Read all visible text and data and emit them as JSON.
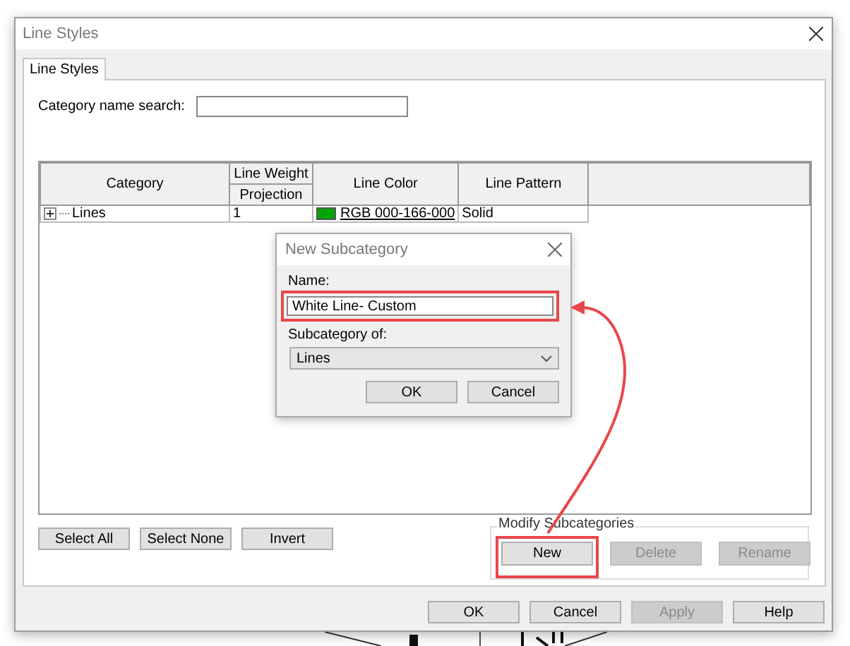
{
  "window": {
    "title": "Line Styles"
  },
  "tabs": [
    {
      "label": "Line Styles",
      "selected": true
    }
  ],
  "search": {
    "label": "Category name search:"
  },
  "table": {
    "group_header": "Line Weight",
    "columns": [
      "Category",
      "Projection",
      "Line Color",
      "Line Pattern"
    ],
    "rows": [
      {
        "category": "Lines",
        "expanded": false,
        "weight": "1",
        "color_label": "RGB 000-166-000",
        "color": "#00a600",
        "pattern": "Solid"
      }
    ]
  },
  "selection_buttons": [
    "Select All",
    "Select None",
    "Invert"
  ],
  "modify_subcategories": {
    "title": "Modify Subcategories",
    "buttons": [
      {
        "label": "New",
        "disabled": false,
        "highlighted": true
      },
      {
        "label": "Delete",
        "disabled": true,
        "highlighted": false
      },
      {
        "label": "Rename",
        "disabled": true,
        "highlighted": false
      }
    ]
  },
  "footer_buttons": [
    {
      "label": "OK",
      "disabled": false
    },
    {
      "label": "Cancel",
      "disabled": false
    },
    {
      "label": "Apply",
      "disabled": true
    },
    {
      "label": "Help",
      "disabled": false
    }
  ],
  "dialog": {
    "title": "New Subcategory",
    "name_label": "Name:",
    "name_value": "White Line- Custom",
    "name_highlighted": true,
    "parent_label": "Subcategory of:",
    "parent_value": "Lines",
    "buttons": [
      "OK",
      "Cancel"
    ]
  },
  "callout": {
    "kind": "curved-arrow"
  }
}
